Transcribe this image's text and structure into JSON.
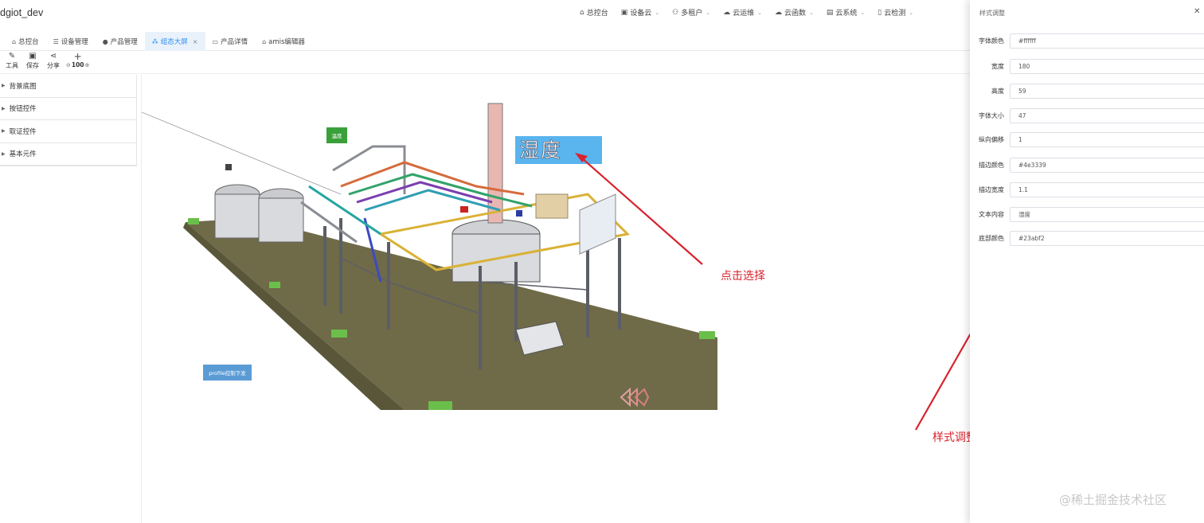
{
  "app": {
    "title": "dgiot_dev"
  },
  "top_nav": [
    {
      "label": "总控台",
      "icon": "home-icon",
      "dropdown": false
    },
    {
      "label": "设备云",
      "icon": "device-icon",
      "dropdown": true
    },
    {
      "label": "多租户",
      "icon": "users-icon",
      "dropdown": true
    },
    {
      "label": "云运维",
      "icon": "cloud-ops-icon",
      "dropdown": true
    },
    {
      "label": "云函数",
      "icon": "cloud-function-icon",
      "dropdown": true
    },
    {
      "label": "云系统",
      "icon": "cloud-system-icon",
      "dropdown": true
    },
    {
      "label": "云检测",
      "icon": "cloud-check-icon",
      "dropdown": true
    }
  ],
  "tabs": [
    {
      "label": "总控台",
      "icon": "home-icon",
      "active": false
    },
    {
      "label": "设备管理",
      "icon": "list-icon",
      "active": false
    },
    {
      "label": "产品管理",
      "icon": "product-icon",
      "active": false
    },
    {
      "label": "组态大屏",
      "icon": "topology-icon",
      "active": true,
      "closable": true
    },
    {
      "label": "产品详情",
      "icon": "detail-icon",
      "active": false
    },
    {
      "label": "amis编辑器",
      "icon": "home-icon",
      "active": false
    }
  ],
  "toolbar": {
    "tools_label": "工具",
    "save_label": "保存",
    "share_label": "分享",
    "zoom_value": "100"
  },
  "left_panel": {
    "categories": [
      "背景底图",
      "按钮控件",
      "取证控件",
      "基本元件"
    ]
  },
  "canvas": {
    "green_label": "温度",
    "selected_text": "湿度",
    "button_label": "profile控制下发"
  },
  "annotations": {
    "click_select": "点击选择",
    "style_adjust": "样式调整"
  },
  "drawer": {
    "title": "样式调整",
    "fields": [
      {
        "label": "字体颜色",
        "value": "#ffffff"
      },
      {
        "label": "宽度",
        "value": "180"
      },
      {
        "label": "高度",
        "value": "59"
      },
      {
        "label": "字体大小",
        "value": "47"
      },
      {
        "label": "纵向偏移",
        "value": "1"
      },
      {
        "label": "描边颜色",
        "value": "#4e3339"
      },
      {
        "label": "描边宽度",
        "value": "1.1"
      },
      {
        "label": "文本内容",
        "value": "湿度"
      },
      {
        "label": "底部颜色",
        "value": "#23abf2"
      }
    ]
  },
  "watermark": "@稀土掘金技术社区",
  "colors": {
    "accent": "#2d8cf0",
    "selected_bg": "#5ab4ee",
    "green_label_bg": "#3aa03a",
    "button_bg": "#5b9bd5",
    "annotation_red": "#d9232e"
  }
}
